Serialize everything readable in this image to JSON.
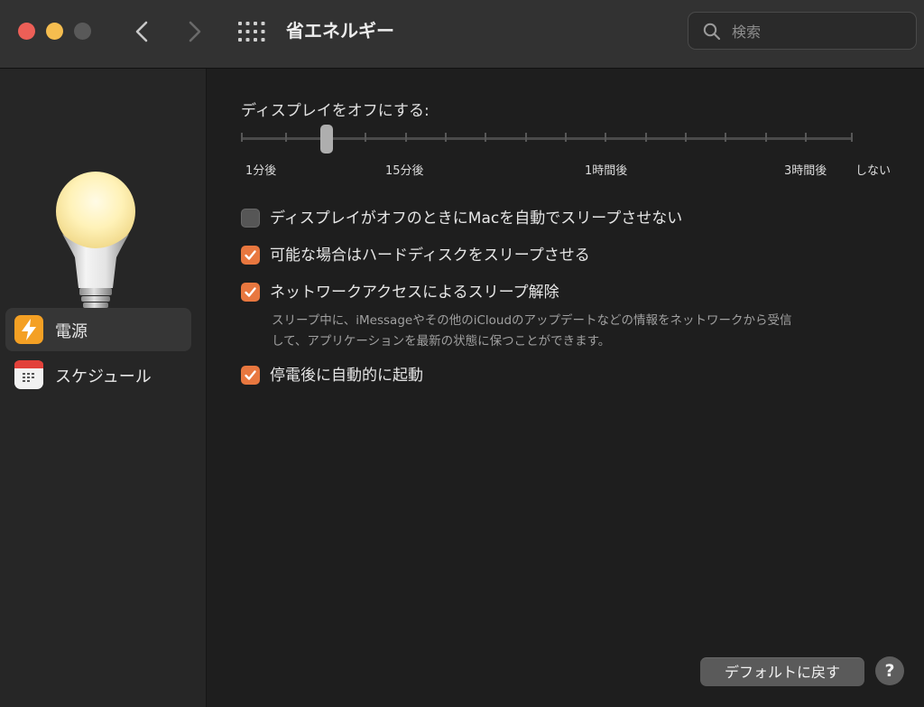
{
  "window": {
    "title": "省エネルギー",
    "search_placeholder": "検索"
  },
  "sidebar": {
    "items": [
      {
        "label": "電源",
        "icon": "lightning-bolt-icon",
        "selected": true
      },
      {
        "label": "スケジュール",
        "icon": "calendar-icon",
        "selected": false
      }
    ]
  },
  "display_sleep": {
    "label": "ディスプレイをオフにする:",
    "value": "15分後",
    "ticks": [
      "1分後",
      "15分後",
      "1時間後",
      "3時間後",
      "しない"
    ]
  },
  "options": [
    {
      "label": "ディスプレイがオフのときにMacを自動でスリープさせない",
      "checked": false
    },
    {
      "label": "可能な場合はハードディスクをスリープさせる",
      "checked": true
    },
    {
      "label": "ネットワークアクセスによるスリープ解除",
      "checked": true
    },
    {
      "label": "停電後に自動的に起動",
      "checked": true
    }
  ],
  "network_description": {
    "line1": "スリープ中に、iMessageやその他のiCloudのアップデートなどの情報をネットワークから受信",
    "line2": "して、アプリケーションを最新の状態に保つことができます。"
  },
  "buttons": {
    "defaults": "デフォルトに戻す",
    "help": "?"
  },
  "colors": {
    "accent": "#e8773f",
    "window_bg": "#1e1e1e",
    "sidebar_bg": "#262626",
    "titlebar_bg": "#323232"
  }
}
